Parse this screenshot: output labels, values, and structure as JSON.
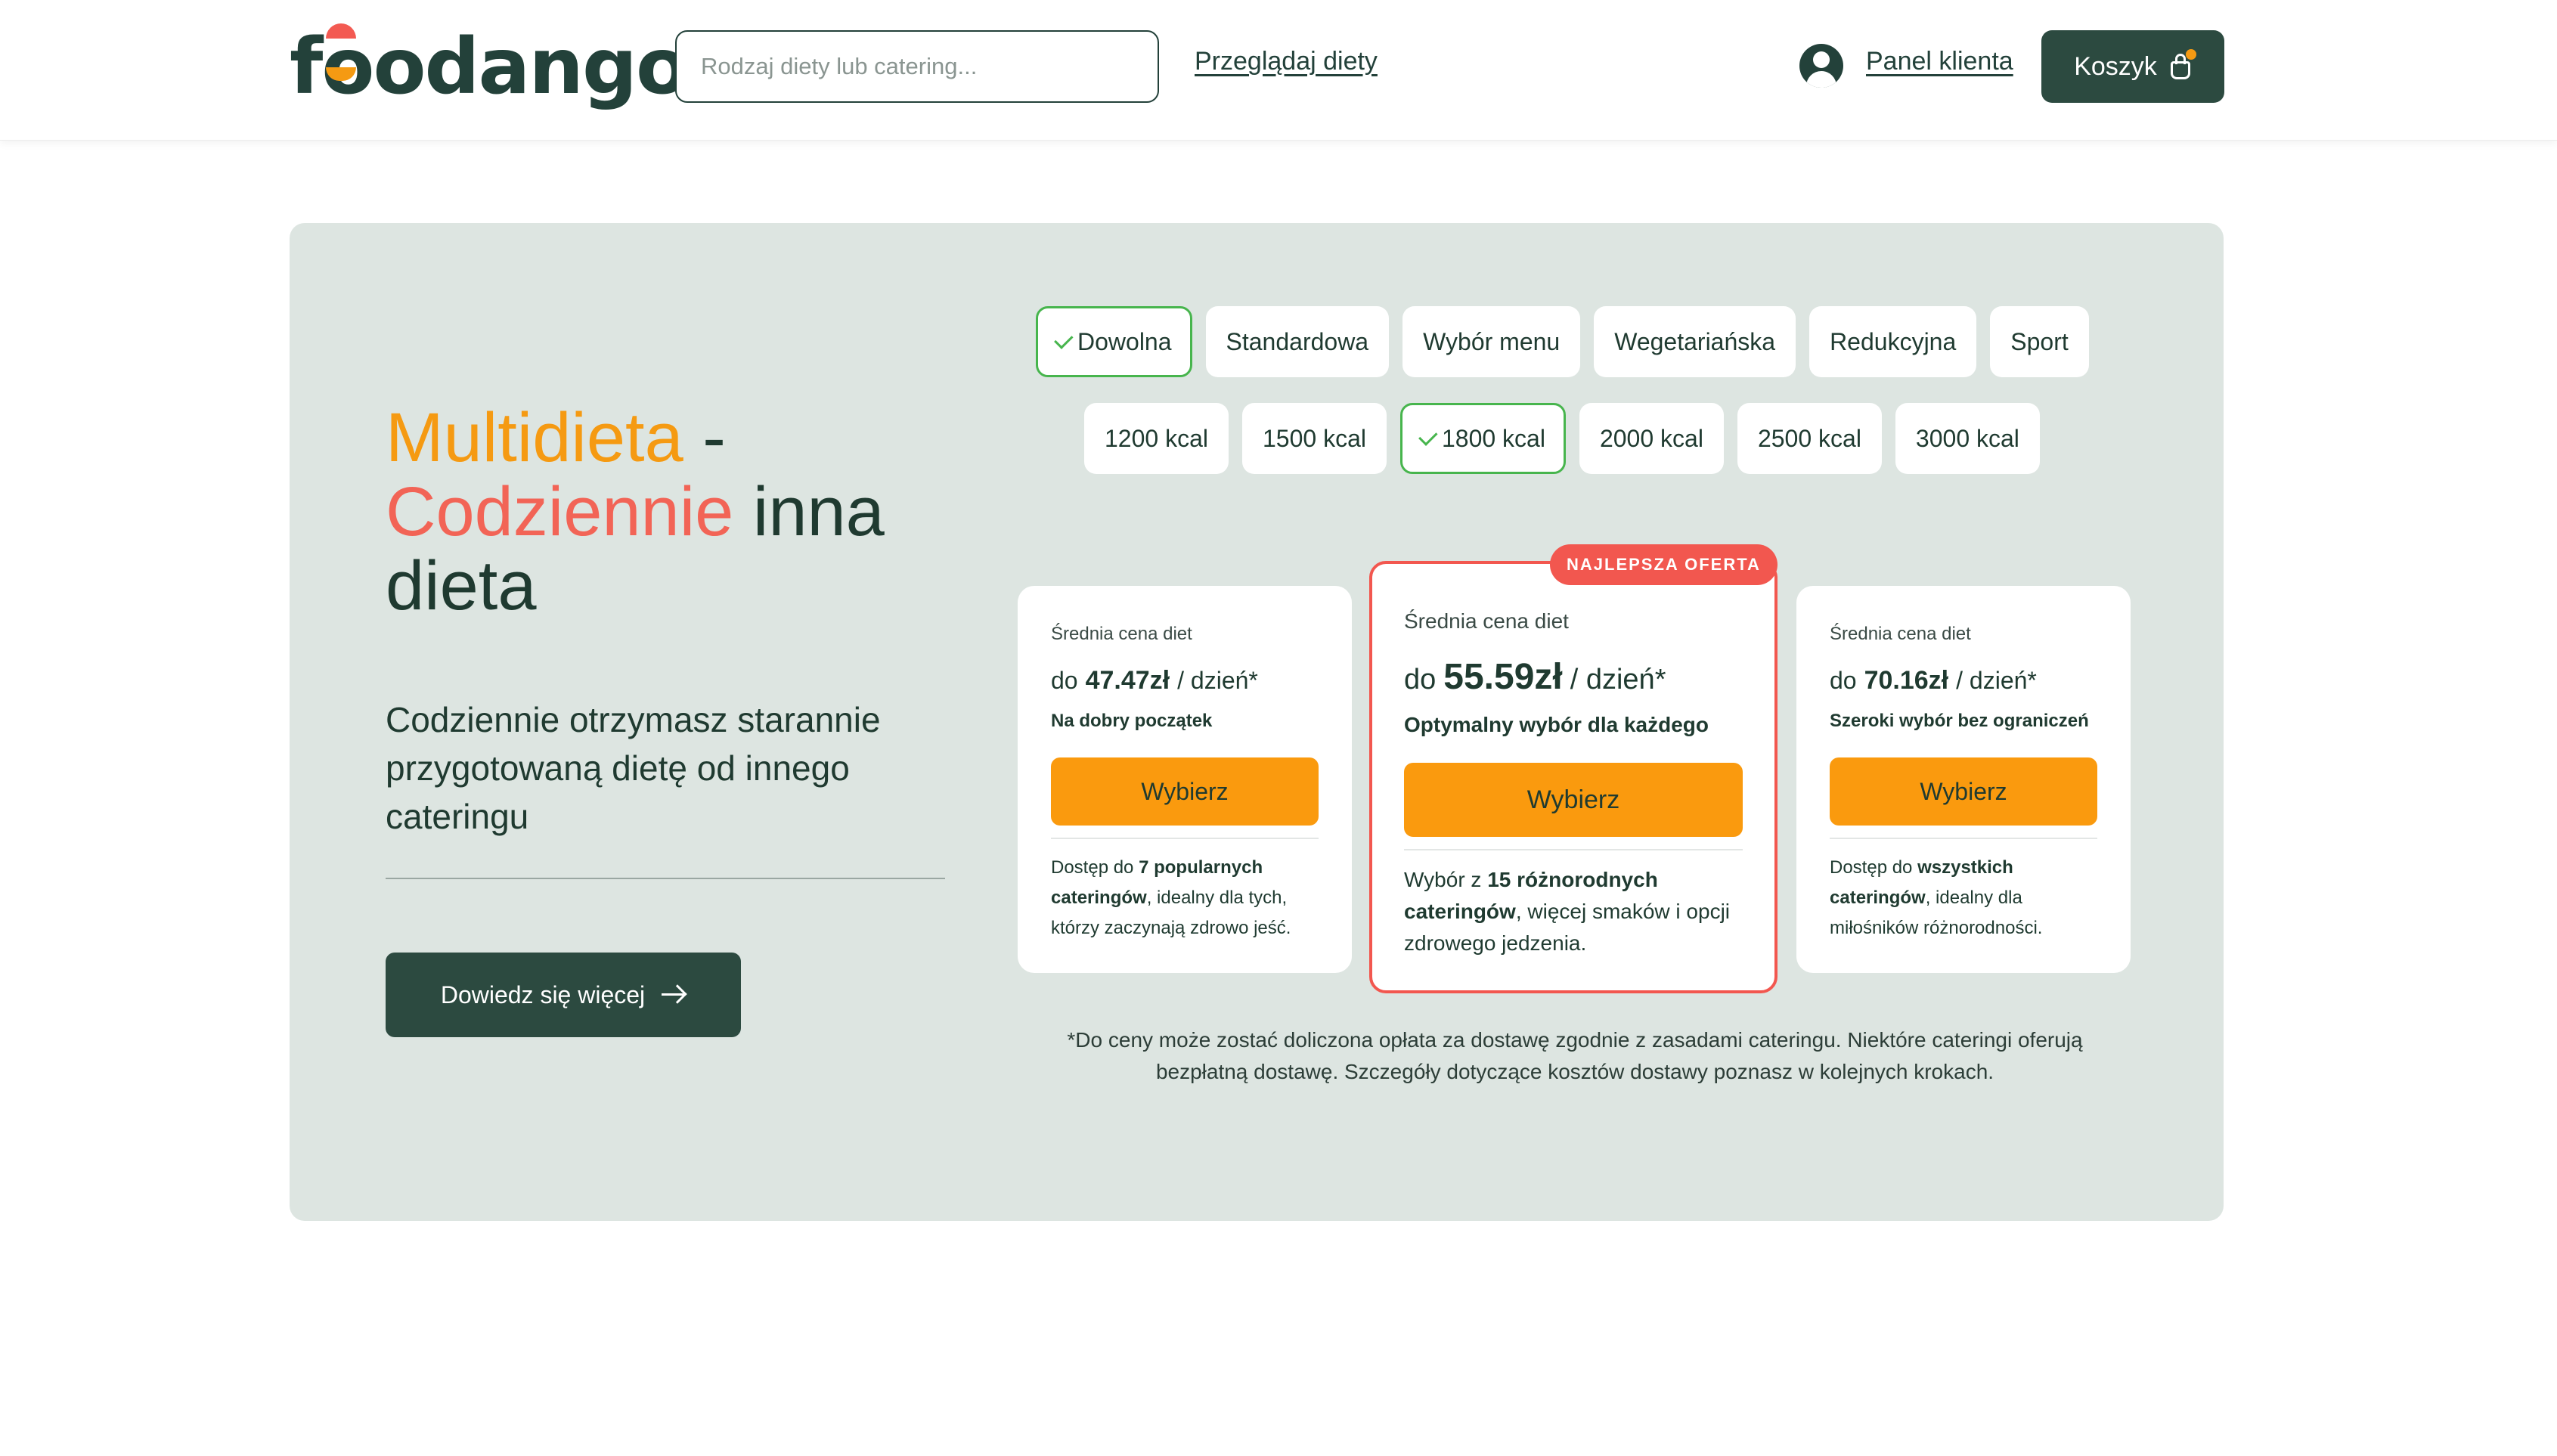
{
  "header": {
    "logo": "foodango",
    "search_placeholder": "Rodzaj diety lub catering...",
    "browse_link": "Przeglądaj diety",
    "panel_link": "Panel klienta",
    "cart_label": "Koszyk"
  },
  "hero": {
    "title_part1": "Multidieta",
    "title_part2": " -",
    "title_part3": "Codziennie",
    "title_part4": " inna dieta",
    "subtitle": "Codziennie otrzymasz starannie przygotowaną dietę od innego cateringu",
    "learn_more": "Dowiedz się więcej"
  },
  "diet_types": [
    {
      "label": "Dowolna",
      "selected": true
    },
    {
      "label": "Standardowa",
      "selected": false
    },
    {
      "label": "Wybór menu",
      "selected": false
    },
    {
      "label": "Wegetariańska",
      "selected": false
    },
    {
      "label": "Redukcyjna",
      "selected": false
    },
    {
      "label": "Sport",
      "selected": false
    }
  ],
  "kcal_options": [
    {
      "label": "1200 kcal",
      "selected": false
    },
    {
      "label": "1500 kcal",
      "selected": false
    },
    {
      "label": "1800 kcal",
      "selected": true
    },
    {
      "label": "2000 kcal",
      "selected": false
    },
    {
      "label": "2500 kcal",
      "selected": false
    },
    {
      "label": "3000 kcal",
      "selected": false
    }
  ],
  "cards": [
    {
      "label": "Średnia cena diet",
      "prefix": "do",
      "price": "47.47zł",
      "unit": "/ dzień*",
      "tagline": "Na dobry początek",
      "button": "Wybierz",
      "desc_a": "Dostęp do ",
      "desc_b": "7 popularnych cateringów",
      "desc_c": ", idealny dla tych, którzy zaczynają zdrowo jeść."
    },
    {
      "badge": "NAJLEPSZA OFERTA",
      "label": "Średnia cena diet",
      "prefix": "do",
      "price": "55.59zł",
      "unit": "/ dzień*",
      "tagline": "Optymalny wybór dla każdego",
      "button": "Wybierz",
      "desc_a": "Wybór z ",
      "desc_b": "15 różnorodnych cateringów",
      "desc_c": ", więcej smaków i opcji zdrowego jedzenia."
    },
    {
      "label": "Średnia cena diet",
      "prefix": "do",
      "price": "70.16zł",
      "unit": "/ dzień*",
      "tagline": "Szeroki wybór bez ograniczeń",
      "button": "Wybierz",
      "desc_a": "Dostęp do ",
      "desc_b": "wszystkich cateringów",
      "desc_c": ", idealny dla miłośników różnorodności."
    }
  ],
  "footnote": "*Do ceny może zostać doliczona opłata za dostawę zgodnie z zasadami cateringu. Niektóre cateringi oferują bezpłatną dostawę. Szczegóły dotyczące kosztów dostawy poznasz w kolejnych krokach.",
  "colors": {
    "brand_dark": "#2c4a40",
    "accent_orange": "#fa9a0e",
    "accent_coral": "#f2574f",
    "selected_green": "#47b54d",
    "hero_bg": "#dde5e1"
  }
}
